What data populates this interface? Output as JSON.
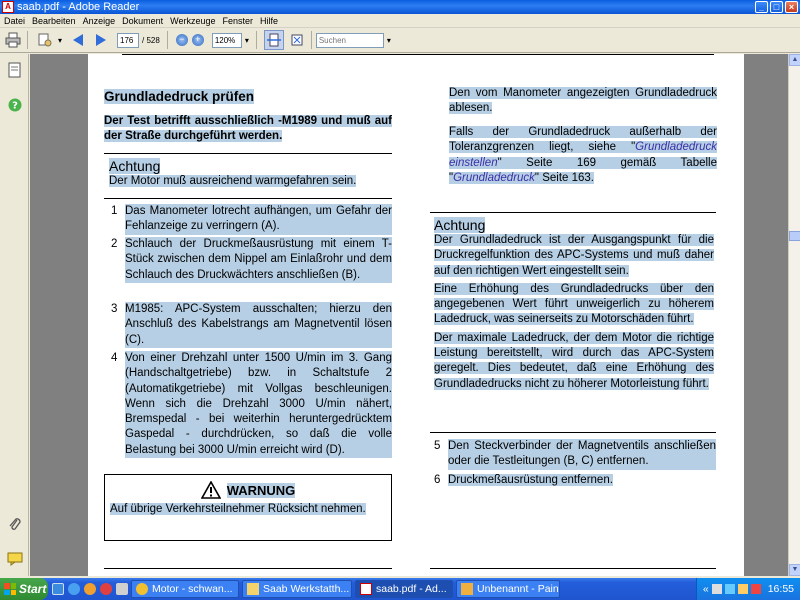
{
  "window": {
    "title": "saab.pdf - Adobe Reader"
  },
  "menu": [
    "Datei",
    "Bearbeiten",
    "Anzeige",
    "Dokument",
    "Werkzeuge",
    "Fenster",
    "Hilfe"
  ],
  "toolbar": {
    "page_current": "176",
    "page_total": "/ 528",
    "zoom": "120%",
    "search_placeholder": "Suchen"
  },
  "doc": {
    "left": {
      "heading": "Grundladedruck prüfen",
      "intro": "Der Test betrifft ausschließlich -M1989 und muß auf der Straße durchgeführt werden.",
      "achtung_title": "Achtung",
      "achtung_text": "Der Motor muß ausreichend warmgefahren sein.",
      "steps": [
        {
          "num": "1",
          "text": "Das Manometer lotrecht aufhängen, um Gefahr der Fehlanzeige zu verringern (A)."
        },
        {
          "num": "2",
          "text": "Schlauch der Druckmeßausrüstung mit einem T-Stück zwischen dem Nippel am Einlaßrohr und dem Schlauch des Druckwächters anschließen (B)."
        },
        {
          "num": "3",
          "text": "M1985: APC-System ausschalten; hierzu den Anschluß des Kabelstrangs am Magnetventil lösen (C)."
        },
        {
          "num": "4",
          "text": "Von einer Drehzahl unter 1500 U/min im 3. Gang (Handschaltgetriebe) bzw. in Schaltstufe 2 (Automatikgetriebe) mit Vollgas beschleunigen. Wenn sich die Drehzahl 3000 U/min nähert, Bremspedal - bei weiterhin heruntergedrücktem Gaspedal - durchdrücken, so daß die volle Belastung bei 3000 U/min erreicht wird (D)."
        }
      ],
      "warning_title": "WARNUNG",
      "warning_text": "Auf übrige Verkehrsteilnehmer Rücksicht nehmen."
    },
    "right": {
      "para1": "Den vom Manometer angezeigten Grundladedruck ablesen.",
      "para2_pre": "Falls der Grundladedruck außerhalb der Toleranzgrenzen liegt, siehe \"",
      "para2_link1": "Grundladedruck einstellen",
      "para2_mid": "\" Seite 169 gemäß Tabelle \"",
      "para2_link2": "Grundladedruck",
      "para2_post": "\" Seite 163.",
      "achtung_title": "Achtung",
      "achtung_p1": "Der Grundladedruck ist der Ausgangspunkt für die Druckregelfunktion des APC-Systems und muß daher auf den richtigen Wert eingestellt sein.",
      "achtung_p2": "Eine Erhöhung des Grundladedrucks über den angegebenen Wert führt unweigerlich zu höherem Ladedruck, was seinerseits zu Motorschäden führt.",
      "achtung_p3": "Der maximale Ladedruck, der dem Motor die richtige Leistung bereitstellt, wird durch das APC-System geregelt. Dies bedeutet, daß eine Erhöhung des Grundladedrucks nicht zu höherer Motorleistung führt.",
      "steps": [
        {
          "num": "5",
          "text": "Den Steckverbinder der Magnetventils anschließen oder die Testleitungen (B, C) entfernen."
        },
        {
          "num": "6",
          "text": "Druckmeßausrüstung entfernen."
        }
      ]
    }
  },
  "taskbar": {
    "start": "Start",
    "tasks": [
      {
        "label": "Motor - schwan...",
        "active": false
      },
      {
        "label": "Saab Werkstatth...",
        "active": false
      },
      {
        "label": "saab.pdf - Ad...",
        "active": true
      },
      {
        "label": "Unbenannt - Paint",
        "active": false
      }
    ],
    "clock": "16:55"
  },
  "colors": {
    "highlight": "#b7cfe4",
    "link": "#3b2fa8",
    "titlebar": "#0a5ee0"
  },
  "icons": [
    "print-icon",
    "hand-tool-icon",
    "prev-page-icon",
    "next-page-icon",
    "zoom-out-icon",
    "zoom-in-icon",
    "fit-width-icon",
    "fit-page-icon",
    "pages-panel-icon",
    "help-icon",
    "attachment-icon",
    "comments-icon",
    "warning-icon"
  ]
}
